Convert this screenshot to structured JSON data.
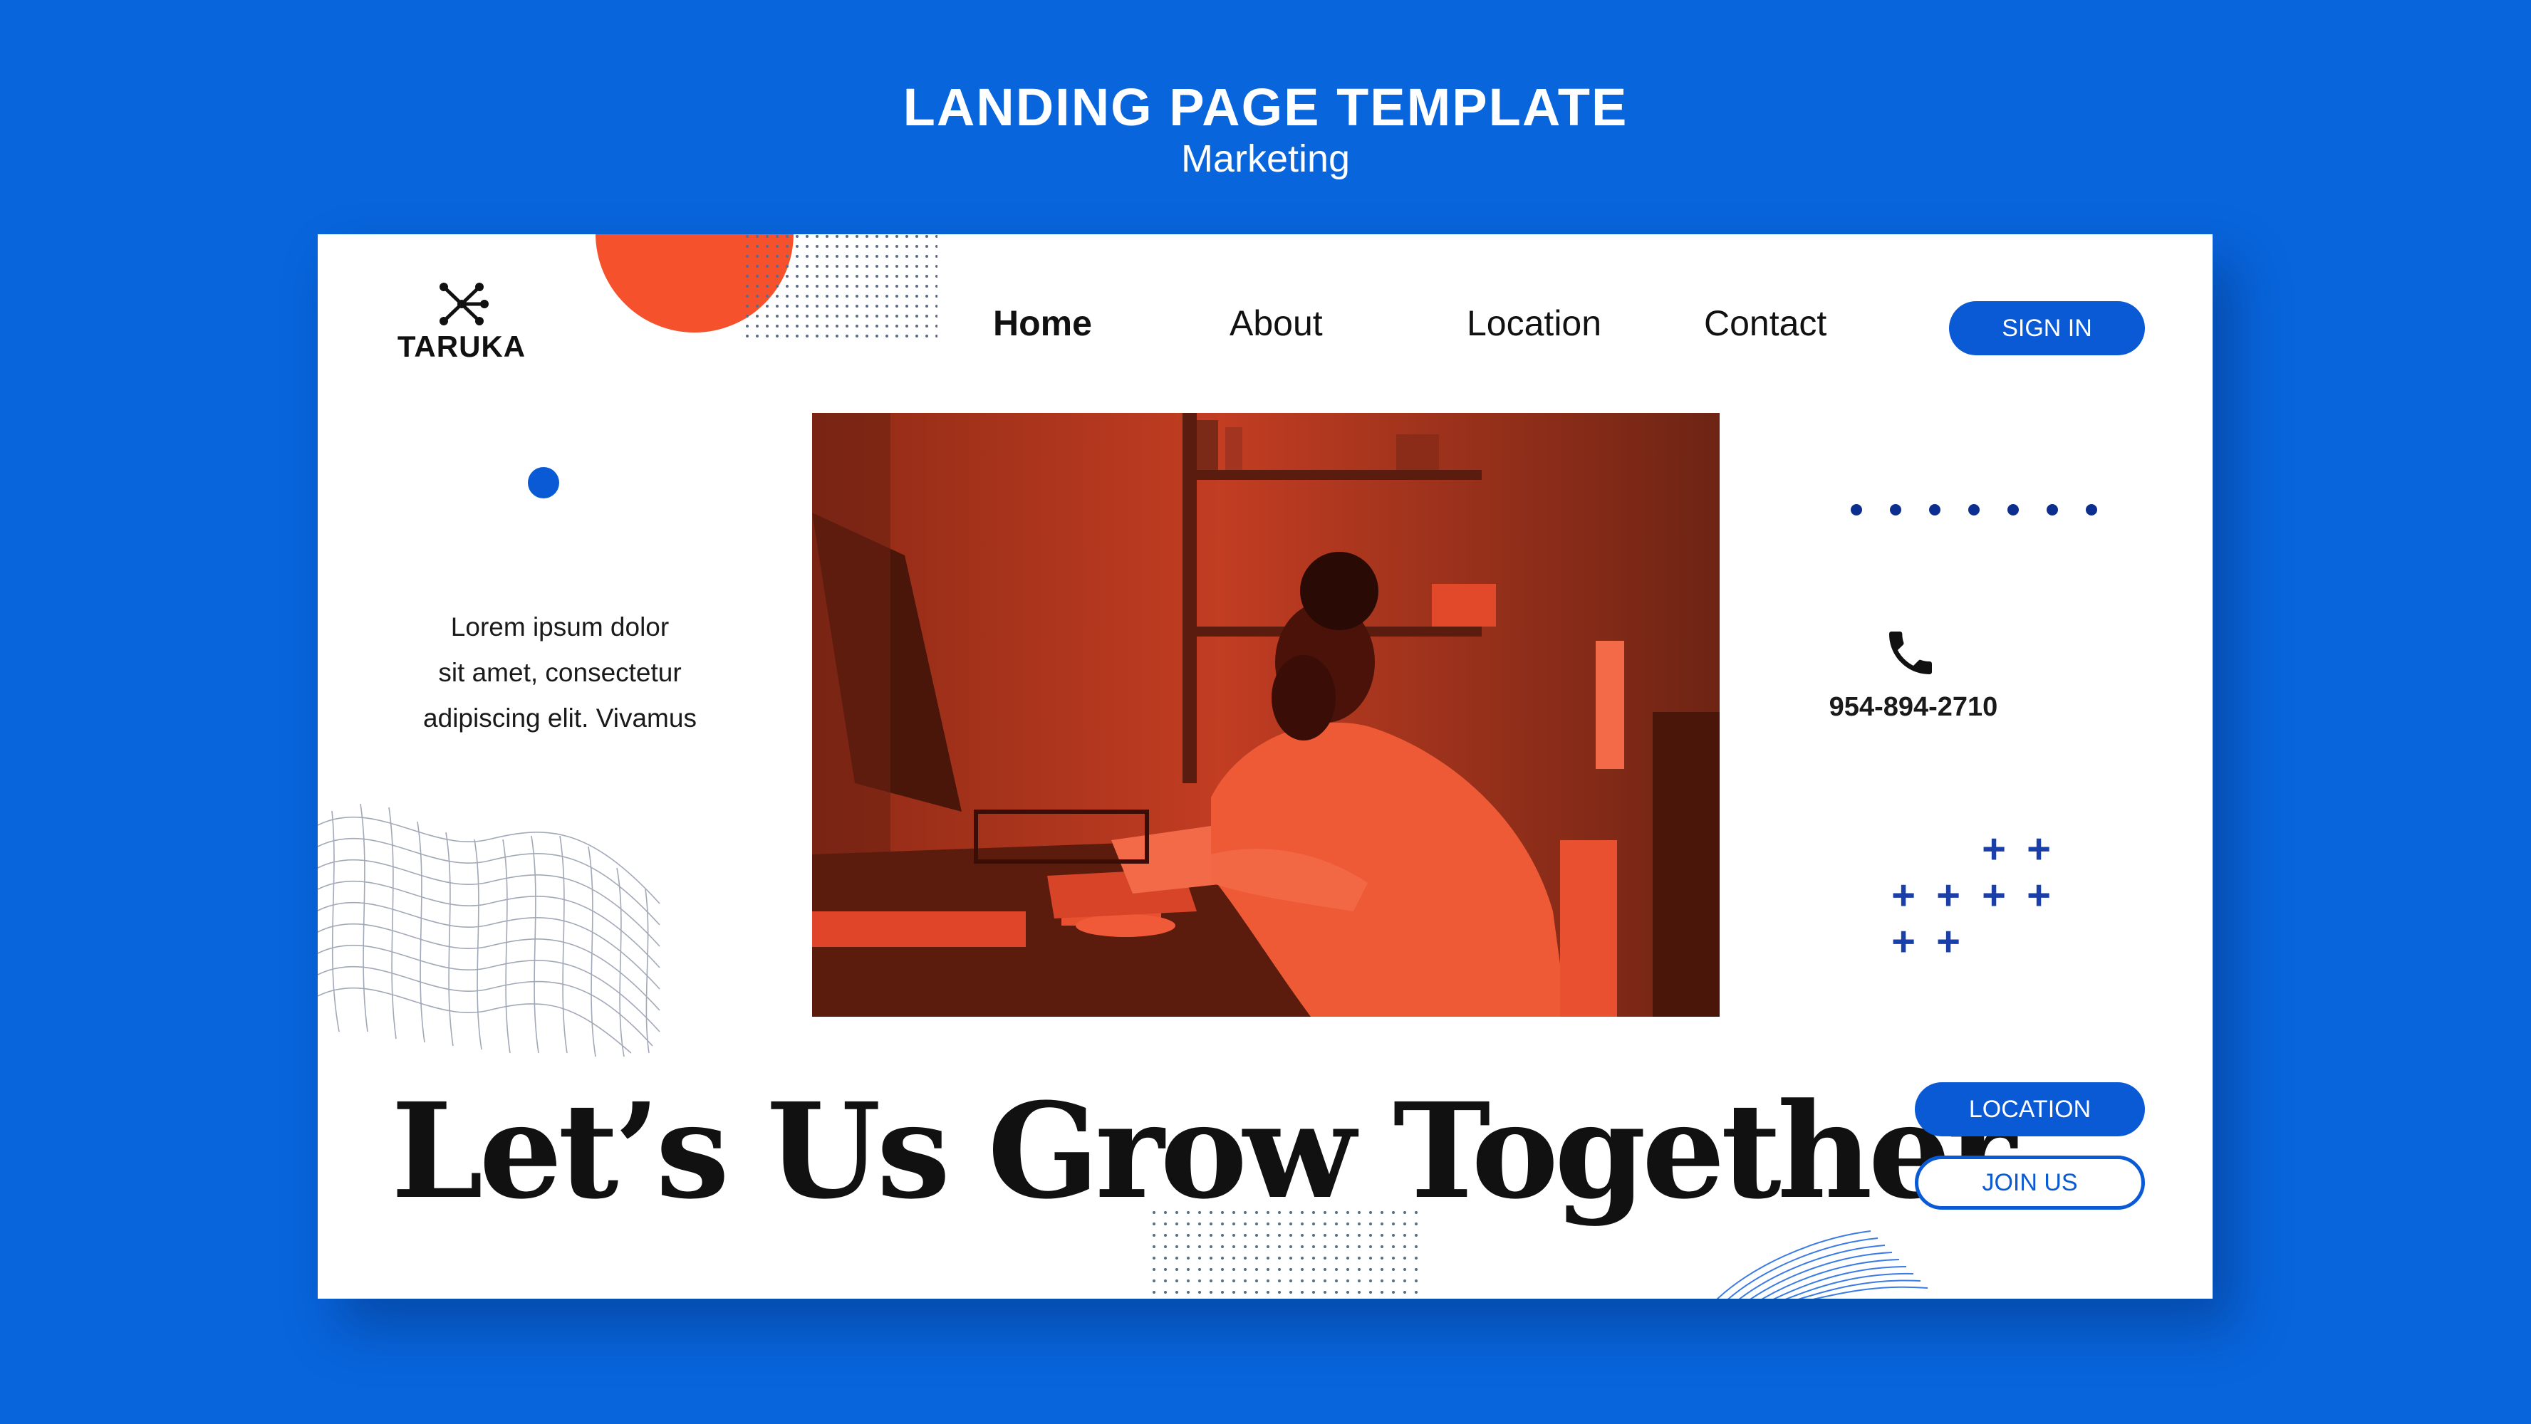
{
  "template": {
    "title": "LANDING PAGE TEMPLATE",
    "subtitle": "Marketing"
  },
  "brand": {
    "name": "TARUKA",
    "logo_icon": "molecule-icon"
  },
  "nav": {
    "items": [
      {
        "label": "Home",
        "active": true
      },
      {
        "label": "About",
        "active": false
      },
      {
        "label": "Location",
        "active": false
      },
      {
        "label": "Contact",
        "active": false
      }
    ],
    "sign_in_label": "SIGN IN"
  },
  "hero": {
    "description": "Lorem ipsum dolor sit amet, consectetur adipiscing elit. Vivamus",
    "description_lines": [
      "Lorem ipsum dolor",
      "sit amet, consectetur",
      "adipiscing elit. Vivamus"
    ],
    "headline": "Let’s Us Grow Together",
    "image_alt": "woman writing at desk"
  },
  "contact": {
    "phone_icon": "phone-icon",
    "phone": "954-894-2710"
  },
  "actions": {
    "location_label": "LOCATION",
    "join_label": "JOIN US"
  },
  "colors": {
    "background": "#0865dc",
    "accent_blue": "#0a5ad6",
    "accent_orange": "#f4512c",
    "photo_tint": "#e2482a",
    "navy": "#1a3fa8"
  }
}
